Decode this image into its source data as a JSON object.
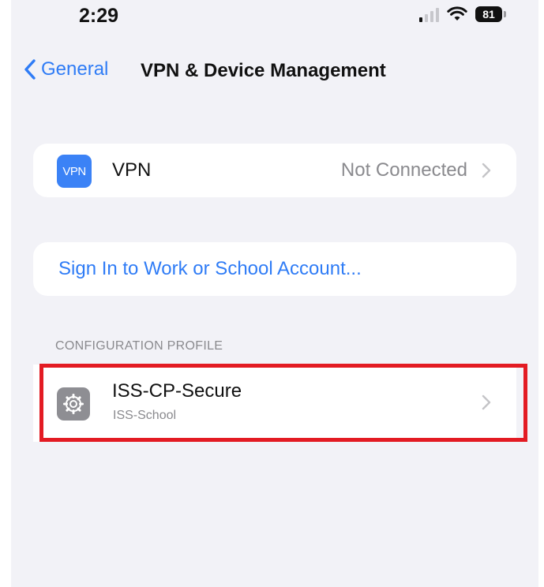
{
  "status_bar": {
    "time": "2:29",
    "battery": "81"
  },
  "nav": {
    "back_label": "General",
    "title": "VPN & Device Management"
  },
  "vpn": {
    "badge": "VPN",
    "label": "VPN",
    "status": "Not Connected"
  },
  "signin": {
    "label": "Sign In to Work or School Account..."
  },
  "configuration_profile": {
    "header": "CONFIGURATION PROFILE",
    "profile": {
      "name": "ISS-CP-Secure",
      "organization": "ISS-School",
      "icon": "gear-icon"
    }
  },
  "colors": {
    "accent": "#2f7cf6",
    "highlight": "#e31b23",
    "background": "#f2f2f7"
  }
}
